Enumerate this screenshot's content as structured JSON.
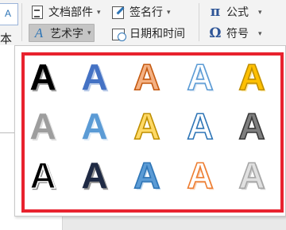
{
  "ribbon": {
    "left_icon_text": "A",
    "left_label": "本框",
    "parts_label": "文档部件",
    "wordart_label": "艺术字",
    "signature_label": "签名行",
    "datetime_label": "日期和时间",
    "equation_label": "公式",
    "symbol_label": "符号",
    "equation_glyph": "π",
    "symbol_glyph": "Ω",
    "wordart_glyph": "A",
    "caret_glyph": "▾"
  },
  "gallery": {
    "letter": "A",
    "styles": [
      {
        "name": "fill-black-shadow",
        "fill": "#000000",
        "stroke": "none",
        "shadow": "#9a9a9a"
      },
      {
        "name": "fill-blue-accent1-shadow",
        "fill": "#4472c4",
        "stroke": "none",
        "shadow": "#b4c7e7"
      },
      {
        "name": "fill-orange-accent2-outline",
        "fill": "#f4b183",
        "stroke": "#c55a11",
        "shadow": "none"
      },
      {
        "name": "fill-white-outline-blue",
        "fill": "#ffffff",
        "stroke": "#5b9bd5",
        "shadow": "#d6e4f2"
      },
      {
        "name": "fill-gold-accent4-bevel",
        "fill": "#ffc000",
        "stroke": "#bf8f00",
        "shadow": "#ffe699"
      },
      {
        "name": "gradient-gray",
        "fill": "#9e9e9e",
        "stroke": "none",
        "shadow": "#dddddd"
      },
      {
        "name": "gradient-blue-reflection",
        "fill": "#5b9bd5",
        "stroke": "none",
        "shadow": "#deebf7"
      },
      {
        "name": "gradient-gold-outline",
        "fill": "#ffd966",
        "stroke": "#bf8f00",
        "shadow": "none"
      },
      {
        "name": "fill-white-outline-blue-2",
        "fill": "#ffffff",
        "stroke": "#2e75b6",
        "shadow": "none"
      },
      {
        "name": "gradient-gray-dark",
        "fill": "#7f7f7f",
        "stroke": "#3a3a3a",
        "shadow": "none"
      },
      {
        "name": "fill-black-white-outline-shadow",
        "fill": "#000000",
        "stroke": "#ffffff",
        "shadow": "#7f7f7f"
      },
      {
        "name": "fill-navy-shadow",
        "fill": "#1f2a44",
        "stroke": "none",
        "shadow": "#8c8c8c"
      },
      {
        "name": "fill-blue-3d",
        "fill": "#5b9bd5",
        "stroke": "#2e75b6",
        "shadow": "#bdd7ee"
      },
      {
        "name": "fill-white-outline-orange",
        "fill": "#ffffff",
        "stroke": "#ed7d31",
        "shadow": "#f8cbad"
      },
      {
        "name": "fill-silver-gradient",
        "fill": "#e0e0e0",
        "stroke": "#a6a6a6",
        "shadow": "#c9c9c9"
      }
    ]
  },
  "colors": {
    "highlight_border": "#e8222e",
    "ribbon_bg": "#f3f3f3",
    "pressed_bg": "#c5c5c5",
    "accent_blue": "#2e75b6"
  }
}
